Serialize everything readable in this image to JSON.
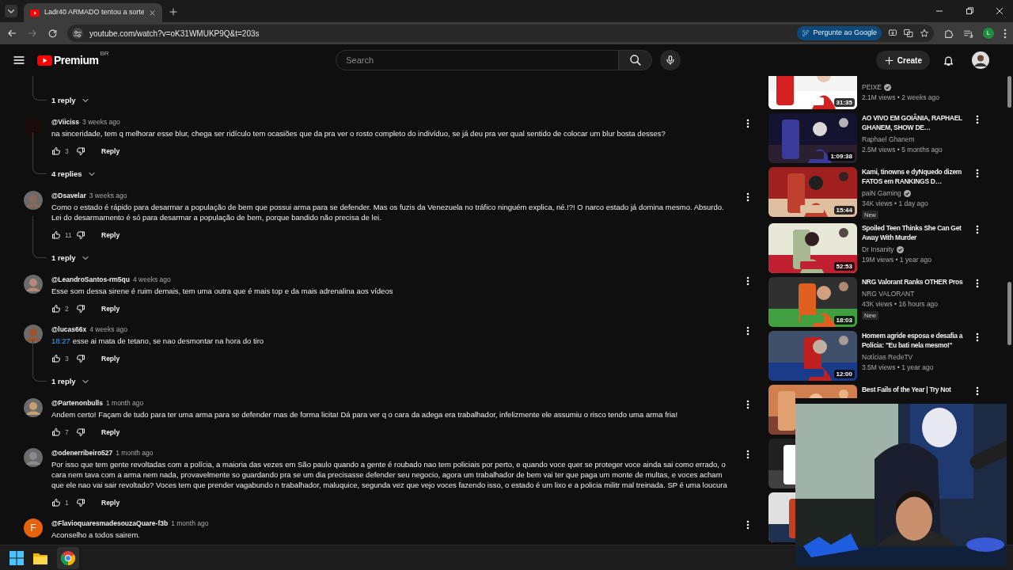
{
  "browser": {
    "tab_title": "Ladr40 ARMADO tentou a sorte",
    "url": "youtube.com/watch?v=oK31WMUKP9Q&t=203s",
    "ask_button": "Pergunte ao Google",
    "profile_initial": "L"
  },
  "header": {
    "logo": "Premium",
    "region": "BR",
    "search_placeholder": "Search",
    "create_label": "Create"
  },
  "comments_section": {
    "leading_replies_label": "1 reply",
    "comments": [
      {
        "author": "@Viiciss",
        "time": "3 weeks ago",
        "text": "na sinceridade, tem q melhorar esse blur, chega ser ridículo tem ocasiões que da pra ver o rosto completo do indivíduo, se já deu pra ver qual sentido de colocar um blur bosta desses?",
        "likes": "3",
        "reply_label": "Reply",
        "replies_label": "4 replies"
      },
      {
        "author": "@Dsavelar",
        "time": "3 weeks ago",
        "text": "Como o estado é rápido para desarmar a população de bem que possui arma para se defender. Mas os fuzis da Venezuela no tráfico ninguém explica, né.!?! O narco estado já domina mesmo. Absurdo. Lei do desarmamento é só para desarmar a população de bem, porque bandido não precisa de lei.",
        "likes": "11",
        "reply_label": "Reply",
        "replies_label": "1 reply"
      },
      {
        "author": "@LeandroSantos-rm5qu",
        "time": "4 weeks ago",
        "text": "Esse som dessa sirene é ruim demais, tem uma outra que é mais top e da mais adrenalina aos vídeos",
        "likes": "2",
        "reply_label": "Reply"
      },
      {
        "author": "@lucas66x",
        "time": "4 weeks ago",
        "timestamp": "18:27",
        "text": "esse ai mata de tetano, se nao desmontar na hora do tiro",
        "likes": "3",
        "reply_label": "Reply",
        "replies_label": "1 reply"
      },
      {
        "author": "@Partenonbulls",
        "time": "1 month ago",
        "text": "Andem certo! Façam de tudo para ter uma arma para se defender mas de forma licita! Dá para ver q o cara da adega era trabalhador, infelizmente ele assumiu o risco tendo uma arma fria!",
        "likes": "7",
        "reply_label": "Reply"
      },
      {
        "author": "@odenerribeiro527",
        "time": "1 month ago",
        "text": "Por isso que tem gente revoltadas com a polícia,  a maioria das vezes em São paulo quando a gente é roubado nao tem policiais por perto, e quando voce quer se proteger voce ainda sai como errado, o cara nem tava com a arma nem nada, provavelmente so guardando pra se um dia precisasse defender seu negocio, agora um trabalhador de bem vai ter que paga um monte de multas, e voces acham que ele nao vai sair revoltado? Voces tem que prender vagabundo n trabalhador, maluquice, segunda vez que vejo voces fazendo isso, o estado é um lixo e a policia militr mal treinada. SP é uma loucura",
        "likes": "1",
        "reply_label": "Reply"
      },
      {
        "author": "@FlavioquaresmadesouzaQuare-f3b",
        "time": "1 month ago",
        "text": "Aconselho a todos sairem.",
        "avatar_letter": "F",
        "color": "#e8620c"
      }
    ]
  },
  "related_videos": [
    {
      "channel": "PEIXE",
      "verified": true,
      "meta": "2.1M views • 2 weeks ago",
      "duration": "31:35"
    },
    {
      "title": "AO VIVO EM GOIÂNIA, RAPHAEL GHANEM, SHOW DE…",
      "channel": "Raphael Ghanem",
      "verified": false,
      "meta": "2.5M views • 5 months ago",
      "duration": "1:09:38"
    },
    {
      "title": "Kami, tinowns e dyNquedo dizem FATOS em RANKINGS D…",
      "channel": "paiN Gaming",
      "verified": true,
      "meta": "34K views • 1 day ago",
      "badge": "New",
      "duration": "15:44"
    },
    {
      "title": "Spoiled Teen Thinks She Can Get Away With Murder",
      "channel": "Dr Insanity",
      "verified": true,
      "meta": "19M views • 1 year ago",
      "duration": "52:53"
    },
    {
      "title": "NRG Valorant Ranks OTHER Pros",
      "channel": "NRG VALORANT",
      "verified": false,
      "meta": "43K views • 16 hours ago",
      "badge": "New",
      "duration": "18:03"
    },
    {
      "title": "Homem agride esposa e desafia a Polícia: \"Eu bati nela mesmo!\"",
      "channel": "Notícias RedeTV",
      "verified": false,
      "meta": "3.5M views • 1 year ago",
      "duration": "12:00"
    },
    {
      "title": "Best Fails of the Year | Try Not"
    }
  ]
}
